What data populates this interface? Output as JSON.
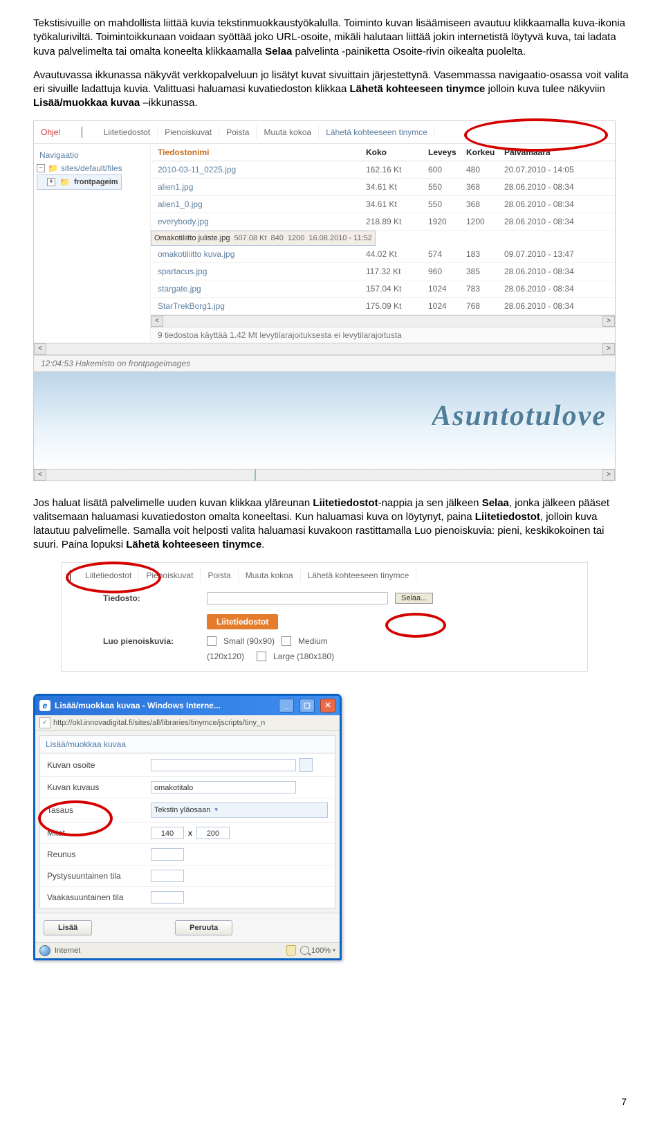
{
  "para1": {
    "a": "Tekstisivuille on mahdollista liittää kuvia tekstinmuokkaustyökalulla. Toiminto kuvan lisäämiseen avautuu klikkaamalla kuva-ikonia työkaluriviltä. Toimintoikkunaan voidaan syöttää joko URL-osoite, mikäli halutaan liittää jokin internetistä löytyvä kuva, tai ladata kuva palvelimelta tai omalta koneelta klikkaamalla ",
    "b": "Selaa",
    "c": " palvelinta -painiketta Osoite-rivin oikealta puolelta."
  },
  "para2": {
    "a": "Avautuvassa ikkunassa näkyvät verkkopalveluun jo lisätyt kuvat sivuittain järjestettynä. Vasemmassa navigaatio-osassa voit valita eri sivuille ladattuja kuvia. Valittuasi haluamasi kuvatiedoston klikkaa ",
    "b": "Lähetä kohteeseen tinymce",
    "c": " jolloin kuva tulee näkyviin ",
    "d": "Lisää/muokkaa kuvaa",
    "e": " –ikkunassa."
  },
  "shot1": {
    "ohje": "Ohje!",
    "tabs": [
      "Liitetiedostot",
      "Pienoiskuvat",
      "Poista",
      "Muuta kokoa",
      "Lähetä kohteeseen tinymce"
    ],
    "nav_header": "Navigaatio",
    "tree_root": "sites/default/files",
    "tree_sel": "frontpageim",
    "headers": {
      "name": "Tiedostonimi",
      "size": "Koko",
      "w": "Leveys",
      "h": "Korkeu",
      "date": "Päivämäärä"
    },
    "rows": [
      {
        "n": "2010-03-11_0225.jpg",
        "s": "162.16 Kt",
        "w": "600",
        "h": "480",
        "d": "20.07.2010 - 14:05"
      },
      {
        "n": "alien1.jpg",
        "s": "34.61 Kt",
        "w": "550",
        "h": "368",
        "d": "28.06.2010 - 08:34"
      },
      {
        "n": "alien1_0.jpg",
        "s": "34.61 Kt",
        "w": "550",
        "h": "368",
        "d": "28.06.2010 - 08:34"
      },
      {
        "n": "everybody.jpg",
        "s": "218.89 Kt",
        "w": "1920",
        "h": "1200",
        "d": "28.06.2010 - 08:34"
      },
      {
        "n": "Omakotiliitto juliste.jpg",
        "s": "507.08 Kt",
        "w": "840",
        "h": "1200",
        "d": "16.08.2010 - 11:52",
        "sel": true
      },
      {
        "n": "omakotiliitto kuva.jpg",
        "s": "44.02 Kt",
        "w": "574",
        "h": "183",
        "d": "09.07.2010 - 13:47"
      },
      {
        "n": "spartacus.jpg",
        "s": "117.32 Kt",
        "w": "960",
        "h": "385",
        "d": "28.06.2010 - 08:34"
      },
      {
        "n": "stargate.jpg",
        "s": "157.04 Kt",
        "w": "1024",
        "h": "783",
        "d": "28.06.2010 - 08:34"
      },
      {
        "n": "StarTrekBorg1.jpg",
        "s": "175.09 Kt",
        "w": "1024",
        "h": "768",
        "d": "28.06.2010 - 08:34"
      }
    ],
    "status": "9 tiedostoa käyttää 1.42 Mt levytilarajoituksesta ei levytilarajoitusta",
    "timestamp": "12:04:53 Hakemisto on frontpageimages",
    "preview_text": "Asuntotulove"
  },
  "para3": {
    "a": "Jos haluat lisätä palvelimelle uuden kuvan klikkaa yläreunan ",
    "b": "Liitetiedostot",
    "c": "-nappia ja sen jälkeen ",
    "d": "Selaa",
    "e": ", jonka jälkeen pääset valitsemaan haluamasi kuvatiedoston omalta koneeltasi. Kun haluamasi kuva on löytynyt, paina ",
    "f": "Liitetiedostot",
    "g": ", jolloin kuva latautuu palvelimelle. Samalla voit helposti valita haluamasi kuvakoon rastittamalla Luo pienoiskuvia: pieni, keskikokoinen tai suuri. Paina lopuksi ",
    "h": "Lähetä kohteeseen tinymce",
    "i": "."
  },
  "shot2": {
    "tabs": [
      "Liitetiedostot",
      "Pienoiskuvat",
      "Poista",
      "Muuta kokoa",
      "Lähetä kohteeseen tinymce"
    ],
    "file_label": "Tiedosto:",
    "selaa": "Selaa...",
    "badge": "Liitetiedostot",
    "thumb_label": "Luo pienoiskuvia:",
    "opt_small": "Small (90x90)",
    "opt_medium": "Medium",
    "opt_med_dim": "(120x120)",
    "opt_large": "Large (180x180)"
  },
  "iewin": {
    "title": "Lisää/muokkaa kuvaa - Windows Interne...",
    "url": "http://okl.innovadigital.fi/sites/all/libraries/tinymce/jscripts/tiny_n",
    "formtitle": "Lisää/muokkaa kuvaa",
    "rows": {
      "osoite": "Kuvan osoite",
      "kuvaus": "Kuvan kuvaus",
      "kuvaus_val": "omakotitalo",
      "tasaus": "Tasaus",
      "tasaus_val": "Tekstin yläosaan",
      "mitat": "Mitat",
      "mitat_w": "140",
      "mitat_x": "x",
      "mitat_h": "200",
      "reunus": "Reunus",
      "pysty": "Pystysuuntainen tila",
      "vaaka": "Vaakasuuntainen tila"
    },
    "btn_ok": "Lisää",
    "btn_cancel": "Peruuta",
    "status_net": "Internet",
    "zoom": "100%"
  },
  "page_number": "7"
}
